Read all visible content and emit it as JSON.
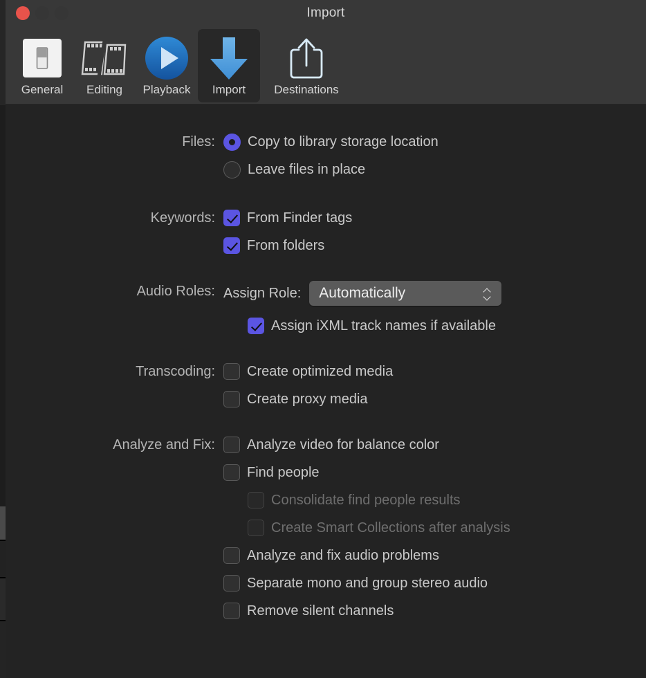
{
  "window": {
    "title": "Import",
    "traffic_lights": [
      {
        "name": "close-button",
        "color": "#e8534b"
      },
      {
        "name": "minimize-button",
        "color": "#363636"
      },
      {
        "name": "zoom-button",
        "color": "#363636"
      }
    ]
  },
  "toolbar": {
    "tabs": [
      {
        "label": "General",
        "icon": "general-switch-icon",
        "selected": false
      },
      {
        "label": "Editing",
        "icon": "editing-filmstrip-icon",
        "selected": false
      },
      {
        "label": "Playback",
        "icon": "playback-play-icon",
        "selected": false
      },
      {
        "label": "Import",
        "icon": "import-arrow-down-icon",
        "selected": true
      },
      {
        "label": "Destinations",
        "icon": "destinations-share-icon",
        "selected": false
      }
    ]
  },
  "accent_color": "#5b55e2",
  "settings": {
    "files": {
      "label": "Files:",
      "options": [
        {
          "label": "Copy to library storage location",
          "selected": true
        },
        {
          "label": "Leave files in place",
          "selected": false
        }
      ]
    },
    "keywords": {
      "label": "Keywords:",
      "options": [
        {
          "label": "From Finder tags",
          "checked": true,
          "disabled": false
        },
        {
          "label": "From folders",
          "checked": true,
          "disabled": false
        }
      ]
    },
    "audio_roles": {
      "label": "Audio Roles:",
      "assign_role_label": "Assign Role:",
      "assign_role_value": "Automatically",
      "options": [
        {
          "label": "Assign iXML track names if available",
          "checked": true,
          "disabled": false
        }
      ]
    },
    "transcoding": {
      "label": "Transcoding:",
      "options": [
        {
          "label": "Create optimized media",
          "checked": false,
          "disabled": false
        },
        {
          "label": "Create proxy media",
          "checked": false,
          "disabled": false
        }
      ]
    },
    "analyze_and_fix": {
      "label": "Analyze and Fix:",
      "options": [
        {
          "label": "Analyze video for balance color",
          "checked": false,
          "disabled": false,
          "indent": false
        },
        {
          "label": "Find people",
          "checked": false,
          "disabled": false,
          "indent": false
        },
        {
          "label": "Consolidate find people results",
          "checked": false,
          "disabled": true,
          "indent": true
        },
        {
          "label": "Create Smart Collections after analysis",
          "checked": false,
          "disabled": true,
          "indent": true
        },
        {
          "label": "Analyze and fix audio problems",
          "checked": false,
          "disabled": false,
          "indent": false
        },
        {
          "label": "Separate mono and group stereo audio",
          "checked": false,
          "disabled": false,
          "indent": false
        },
        {
          "label": "Remove silent channels",
          "checked": false,
          "disabled": false,
          "indent": false
        }
      ]
    }
  }
}
